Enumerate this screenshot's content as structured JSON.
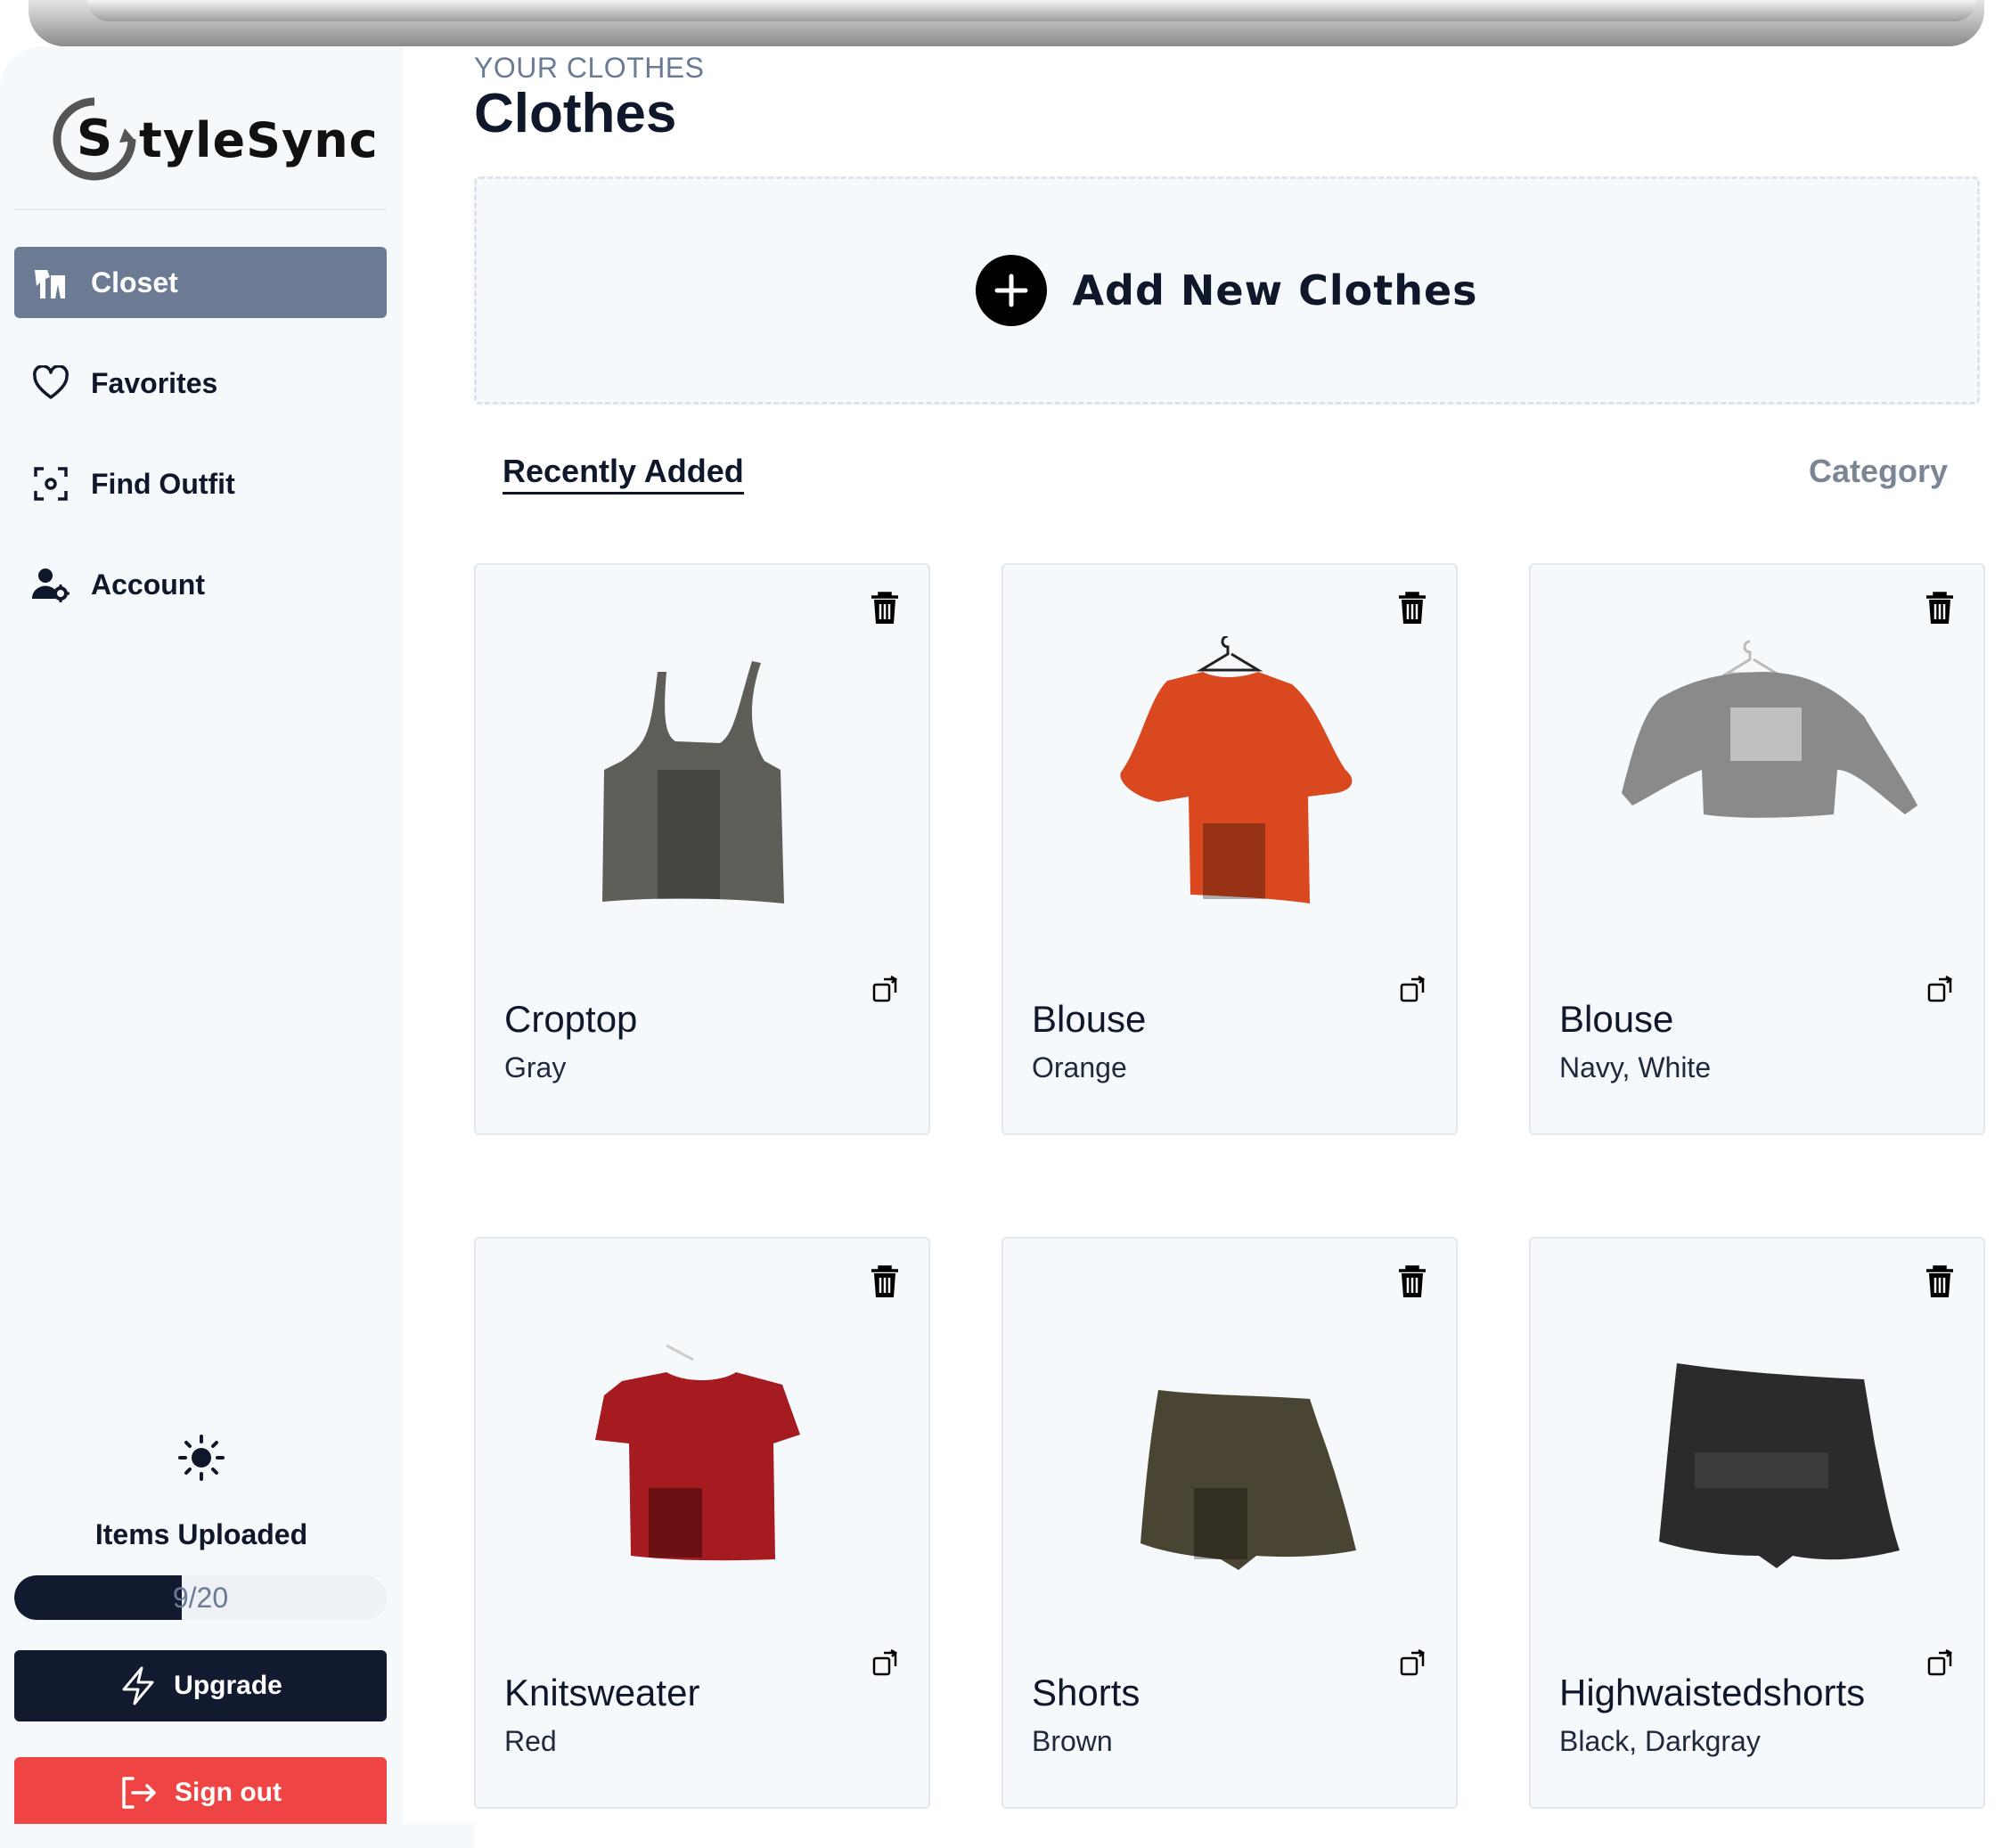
{
  "brand": {
    "name": "tyleSync",
    "logo_letter": "S"
  },
  "sidebar": {
    "items": [
      {
        "label": "Closet",
        "icon": "closet-icon",
        "active": true
      },
      {
        "label": "Favorites",
        "icon": "heart-icon",
        "active": false
      },
      {
        "label": "Find Outfit",
        "icon": "scan-icon",
        "active": false
      },
      {
        "label": "Account",
        "icon": "user-gear-icon",
        "active": false
      }
    ],
    "theme_icon": "sun-icon",
    "items_uploaded": {
      "title": "Items Uploaded",
      "text": "9/20",
      "fraction": 0.45
    },
    "upgrade_label": "Upgrade",
    "signout_label": "Sign out"
  },
  "main": {
    "eyebrow": "YOUR CLOTHES",
    "title": "Clothes",
    "add_label": "Add New Clothes",
    "tabs": {
      "recent": "Recently Added",
      "category": "Category"
    },
    "items": [
      {
        "name": "Croptop",
        "color": "Gray",
        "swatch": "#5f5d58"
      },
      {
        "name": "Blouse",
        "color": "Orange",
        "swatch": "#d9481e"
      },
      {
        "name": "Blouse",
        "color": "Navy, White",
        "swatch": "#8a8a8a"
      },
      {
        "name": "Knitsweater",
        "color": "Red",
        "swatch": "#a51b1f"
      },
      {
        "name": "Shorts",
        "color": "Brown",
        "swatch": "#4a4433"
      },
      {
        "name": "Highwaistedshorts",
        "color": "Black, Darkgray",
        "swatch": "#2b2b2e"
      }
    ]
  },
  "colors": {
    "accent": "#6b7b94",
    "dark": "#111a2e",
    "danger": "#ef4444",
    "surface": "#f6f9fc"
  }
}
